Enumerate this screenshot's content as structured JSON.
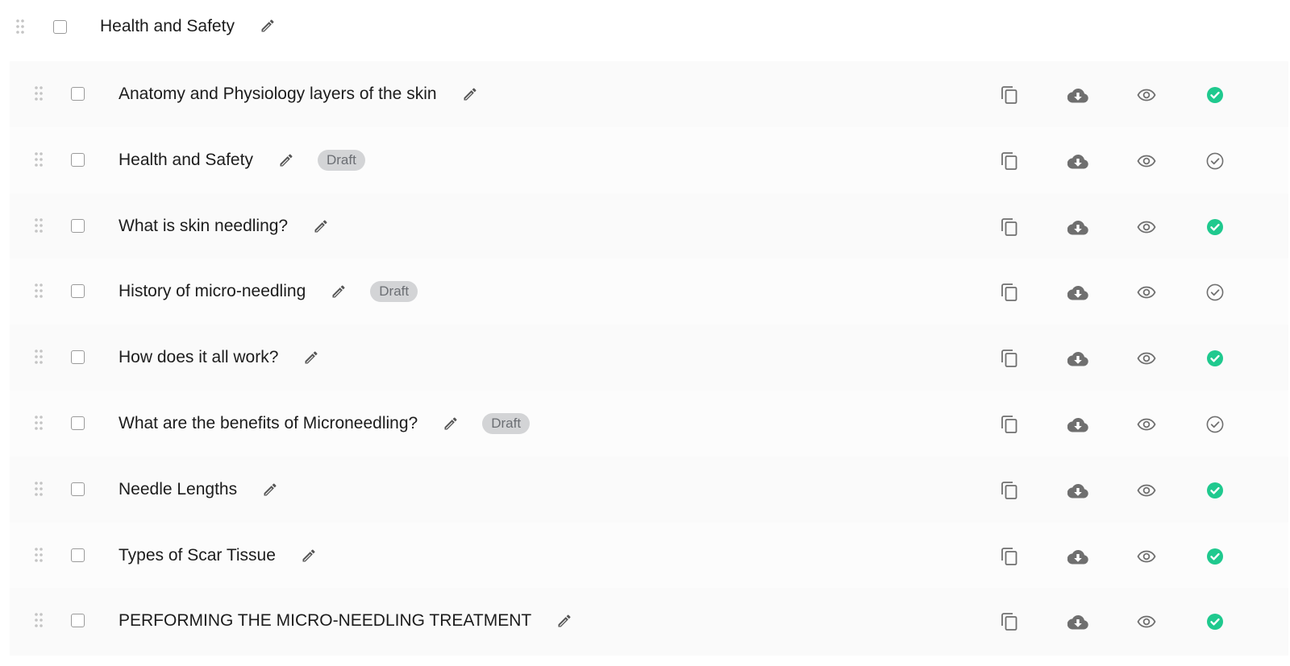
{
  "section": {
    "title": "Health and Safety"
  },
  "lessons": [
    {
      "title": "Anatomy and Physiology layers of the skin",
      "badge": "",
      "published": true
    },
    {
      "title": "Health and Safety",
      "badge": "Draft",
      "published": false
    },
    {
      "title": "What is skin needling?",
      "badge": "",
      "published": true
    },
    {
      "title": "History of micro-needling",
      "badge": "Draft",
      "published": false
    },
    {
      "title": "How does it all work?",
      "badge": "",
      "published": true
    },
    {
      "title": "What are the benefits of Microneedling?",
      "badge": "Draft",
      "published": false
    },
    {
      "title": "Needle Lengths",
      "badge": "",
      "published": true
    },
    {
      "title": "Types of Scar Tissue",
      "badge": "",
      "published": true
    },
    {
      "title": "PERFORMING THE MICRO-NEEDLING TREATMENT",
      "badge": "",
      "published": true
    }
  ],
  "icons": {
    "drag": "drag-handle-icon",
    "edit": "pencil-icon",
    "copy": "copy-icon",
    "download": "cloud-download-icon",
    "preview": "eye-icon",
    "published": "check-circle-filled-icon",
    "unpublished": "check-circle-outline-icon"
  },
  "colors": {
    "published_green": "#1fc98e",
    "icon_gray": "#6f6f6f",
    "badge_bg": "#d3d4d6",
    "badge_text": "#6b6e73"
  }
}
